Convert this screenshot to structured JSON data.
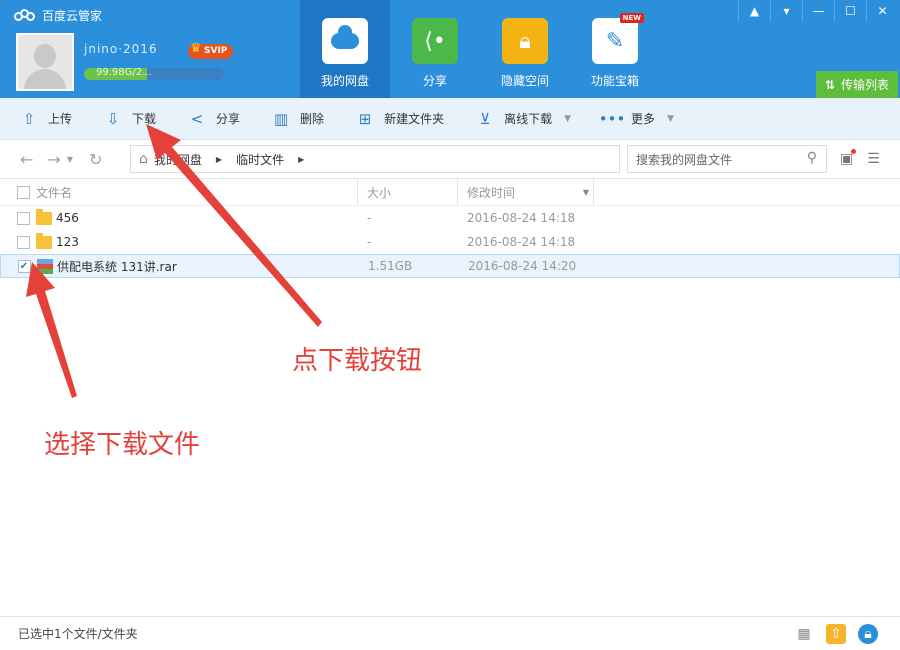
{
  "app": {
    "title": "百度云管家"
  },
  "user": {
    "name": "jnino·2016",
    "vip_badge": "SVIP",
    "quota_text": "99.98G/2...",
    "quota_used_fraction": 0.45
  },
  "nav": [
    {
      "label": "我的网盘",
      "icon": "cloud-icon",
      "active": true
    },
    {
      "label": "分享",
      "icon": "share-icon"
    },
    {
      "label": "隐藏空间",
      "icon": "lock-icon"
    },
    {
      "label": "功能宝箱",
      "icon": "wrench-icon",
      "badge": "NEW"
    }
  ],
  "window": {
    "transfer_label": "传输列表"
  },
  "toolbar": {
    "upload": "上传",
    "download": "下载",
    "share": "分享",
    "delete": "删除",
    "new_folder": "新建文件夹",
    "offline": "离线下载",
    "more": "更多"
  },
  "path": {
    "root": "我的网盘",
    "current": "临时文件"
  },
  "search": {
    "placeholder": "搜索我的网盘文件"
  },
  "columns": {
    "name": "文件名",
    "size": "大小",
    "time": "修改时间"
  },
  "files": [
    {
      "name": "456",
      "size": "-",
      "time": "2016-08-24 14:18",
      "type": "folder",
      "checked": false
    },
    {
      "name": "123",
      "size": "-",
      "time": "2016-08-24 14:18",
      "type": "folder",
      "checked": false
    },
    {
      "name": "供配电系统 131讲.rar",
      "size": "1.51GB",
      "time": "2016-08-24 14:20",
      "type": "rar",
      "checked": true
    }
  ],
  "annotations": {
    "download_hint": "点下载按钮",
    "select_hint": "选择下载文件"
  },
  "status": {
    "text": "已选中1个文件/文件夹"
  },
  "colors": {
    "header": "#2b8fdc",
    "accent_green": "#5ebd3a",
    "annotation": "#e3413a"
  }
}
